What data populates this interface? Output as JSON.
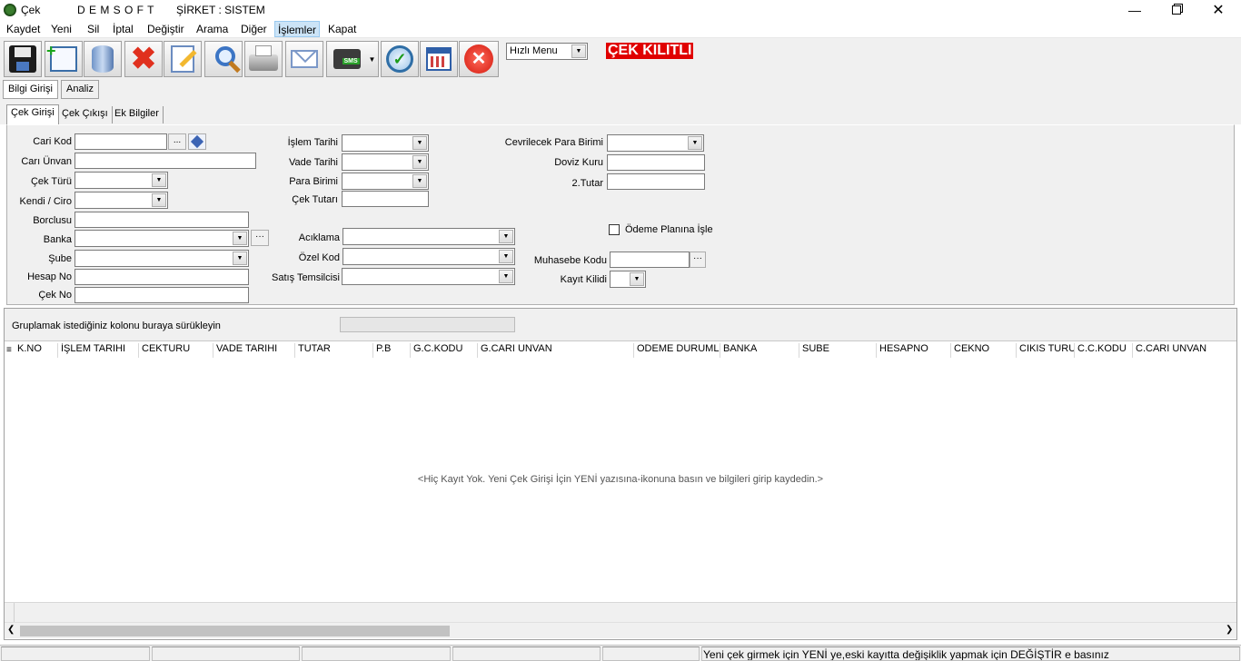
{
  "window": {
    "app": "Çek",
    "brand": "D E M S O F T",
    "company": "ŞİRKET : SISTEM"
  },
  "menu": [
    "Kaydet",
    "Yeni",
    "Sil",
    "İptal",
    "Değiştir",
    "Arama",
    "Diğer",
    "İşlemler",
    "Kapat"
  ],
  "menu_active": "İşlemler",
  "toolbar": {
    "buttons": [
      "save-icon",
      "new-icon",
      "database-icon",
      "delete-icon",
      "edit-icon",
      "search-icon",
      "print-icon",
      "mail-icon",
      "sms-icon",
      "refresh-icon",
      "calendar-icon",
      "close-icon"
    ],
    "quick_menu": "Hızlı Menu",
    "lock_badge": "ÇEK KILITLI"
  },
  "top_tabs": [
    "Bilgi Girişi",
    "Analiz"
  ],
  "sub_tabs": [
    "Çek Girişi",
    "Çek Çıkışı",
    "Ek Bilgiler"
  ],
  "form": {
    "cari_kod": "Cari Kod",
    "cari_unvan": "Carı Ünvan",
    "cek_turu": "Çek Türü",
    "kendi_ciro": "Kendi / Ciro",
    "borclusu": "Borclusu",
    "banka": "Banka",
    "sube": "Şube",
    "hesap_no": "Hesap No",
    "cek_no": "Çek No",
    "islem_tarihi": "İşlem Tarihi",
    "vade_tarihi": "Vade Tarihi",
    "para_birimi": "Para Birimi",
    "cek_tutari": "Çek Tutarı",
    "aciklama": "Acıklama",
    "ozel_kod": "Özel Kod",
    "satis_temsilcisi": "Satış Temsilcisi",
    "cevrilecek_para_birimi": "Cevrilecek Para Birimi",
    "doviz_kuru": "Doviz Kuru",
    "tutar2": "2.Tutar",
    "odeme_plani": "Ödeme Planına İşle",
    "muhasebe_kodu": "Muhasebe Kodu",
    "kayit_kilidi": "Kayıt Kilidi"
  },
  "grid": {
    "group_hint": "Gruplamak istediğiniz kolonu buraya sürükleyin",
    "columns": [
      "K.NO",
      "İŞLEM TARIHI",
      "CEKTURU",
      "VADE TARIHI",
      "TUTAR",
      "P.B",
      "G.C.KODU",
      "G.CARI UNVAN",
      "ODEME DURUML",
      "BANKA",
      "SUBE",
      "HESAPNO",
      "CEKNO",
      "CIKIS TURU",
      "C.C.KODU",
      "C.CARI UNVAN"
    ],
    "empty_message": "<Hiç Kayıt Yok. Yeni Çek Girişi İçin YENİ yazısına-ikonuna basın ve bilgileri girip kaydedin.>"
  },
  "status": {
    "message": "Yeni çek girmek için YENİ ye,eski kayıtta değişiklik yapmak için DEĞİŞTİR e basınız"
  }
}
